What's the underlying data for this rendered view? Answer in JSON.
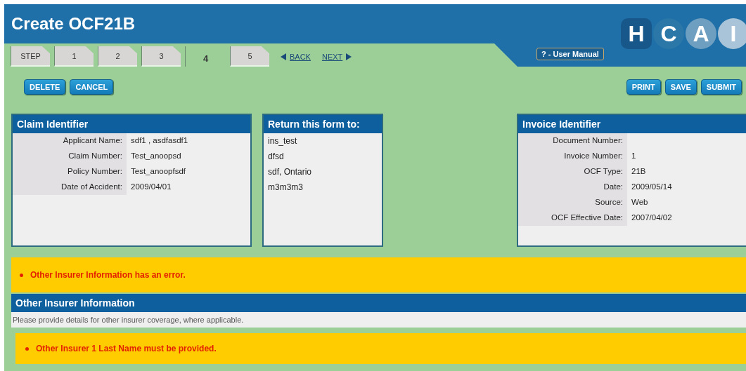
{
  "header": {
    "title": "Create OCF21B",
    "logo_letters": [
      "H",
      "C",
      "A",
      "I"
    ],
    "user_manual": "? - User Manual"
  },
  "tabs": [
    {
      "label": "STEP",
      "selected": false
    },
    {
      "label": "1",
      "selected": false
    },
    {
      "label": "2",
      "selected": false
    },
    {
      "label": "3",
      "selected": false
    },
    {
      "label": "4",
      "selected": true
    },
    {
      "label": "5",
      "selected": false
    }
  ],
  "nav": {
    "back": "BACK",
    "next": "NEXT"
  },
  "left_buttons": [
    "DELETE",
    "CANCEL"
  ],
  "right_buttons": [
    "PRINT",
    "SAVE",
    "SUBMIT"
  ],
  "panels": [
    {
      "kind": "fields",
      "title": "Claim Identifier",
      "fields": [
        {
          "label": "Applicant Name:",
          "value": "sdf1 , asdfasdf1"
        },
        {
          "label": "Claim Number:",
          "value": "Test_anoopsd"
        },
        {
          "label": "Policy Number:",
          "value": "Test_anoopfsdf"
        },
        {
          "label": "Date of Accident:",
          "value": "2009/04/01"
        }
      ]
    },
    {
      "kind": "lines",
      "title": "Return this form to:",
      "lines": [
        "ins_test",
        "dfsd",
        "sdf, Ontario",
        "m3m3m3"
      ]
    },
    {
      "kind": "fields",
      "title": "Invoice Identifier",
      "fields": [
        {
          "label": "Document Number:"
        },
        {
          "label": "Invoice Number:",
          "value": "1"
        },
        {
          "label": "OCF Type:",
          "value": "21B"
        },
        {
          "label": "Date:",
          "value": "2009/05/14"
        },
        {
          "label": "Source:",
          "value": "Web"
        },
        {
          "label": "OCF Effective Date:",
          "value": "2007/04/02"
        }
      ]
    }
  ],
  "error": "Other Insurer Information has an error.",
  "section": {
    "title": "Other Insurer Information",
    "note": "Please provide details for other insurer coverage, where applicable.",
    "error": "Other Insurer 1 Last Name must be provided."
  }
}
